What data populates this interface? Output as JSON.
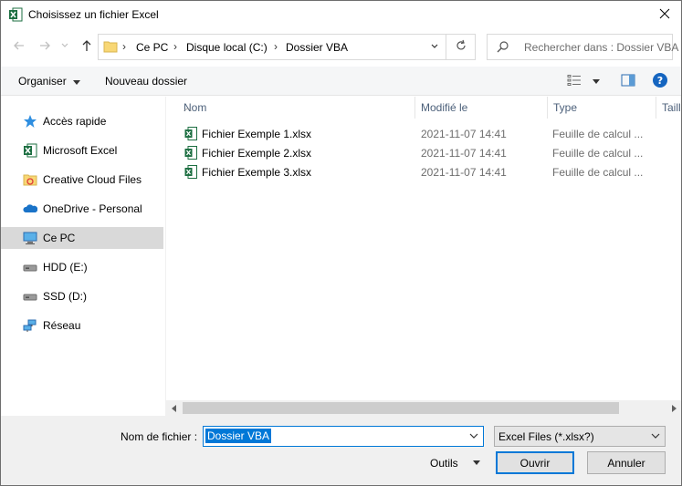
{
  "window": {
    "title": "Choisissez un fichier Excel",
    "app_icon": "excel-icon",
    "close_icon": "close-icon"
  },
  "address_bar": {
    "breadcrumbs": [
      "Ce PC",
      "Disque local (C:)",
      "Dossier VBA"
    ],
    "separator": ">",
    "folder_icon": "folder-icon"
  },
  "search": {
    "placeholder": "Rechercher dans : Dossier VBA"
  },
  "toolbar": {
    "organize_label": "Organiser",
    "new_folder_label": "Nouveau dossier",
    "help_icon": "help-icon"
  },
  "nav_pane": {
    "items": [
      {
        "label": "Accès rapide",
        "icon": "star-icon",
        "selected": false
      },
      {
        "label": "Microsoft Excel",
        "icon": "excel-icon",
        "selected": false
      },
      {
        "label": "Creative Cloud Files",
        "icon": "cloud-folder-icon",
        "selected": false
      },
      {
        "label": "OneDrive - Personal",
        "icon": "onedrive-icon",
        "selected": false
      },
      {
        "label": "Ce PC",
        "icon": "computer-icon",
        "selected": true
      },
      {
        "label": "HDD (E:)",
        "icon": "drive-icon",
        "selected": false
      },
      {
        "label": "SSD (D:)",
        "icon": "drive-icon",
        "selected": false
      },
      {
        "label": "Réseau",
        "icon": "network-icon",
        "selected": false
      }
    ]
  },
  "file_list": {
    "columns": [
      "Nom",
      "Modifié le",
      "Type",
      "Taille"
    ],
    "rows": [
      {
        "name": "Fichier Exemple 1.xlsx",
        "modified": "2021-11-07 14:41",
        "type": "Feuille de calcul ..."
      },
      {
        "name": "Fichier Exemple 2.xlsx",
        "modified": "2021-11-07 14:41",
        "type": "Feuille de calcul ..."
      },
      {
        "name": "Fichier Exemple 3.xlsx",
        "modified": "2021-11-07 14:41",
        "type": "Feuille de calcul ..."
      }
    ]
  },
  "bottom": {
    "filename_label": "Nom de fichier :",
    "filename_value": "Dossier VBA",
    "filter_value": "Excel Files (*.xlsx?)",
    "tools_label": "Outils",
    "open_label": "Ouvrir",
    "cancel_label": "Annuler"
  },
  "colors": {
    "accent": "#0078d7",
    "selected_nav": "#d9d9d9",
    "excel_green": "#1d6f42"
  }
}
